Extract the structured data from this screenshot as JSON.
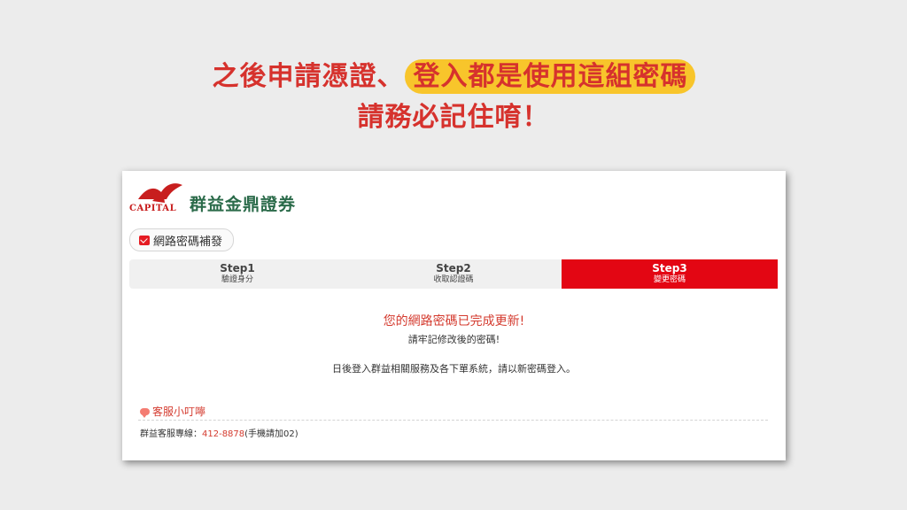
{
  "headline": {
    "line1_prefix": "之後申請憑證、",
    "line1_highlight": "登入都是使用這組密碼",
    "line2": "請務必記住唷！"
  },
  "logo": {
    "capital": "CAPITAL",
    "name": "群益金鼎證券"
  },
  "page_button": {
    "label": "網路密碼補發",
    "icon": "check-mail-icon"
  },
  "steps": [
    {
      "title": "Step1",
      "sub": "驗證身分"
    },
    {
      "title": "Step2",
      "sub": "收取認證碼"
    },
    {
      "title": "Step3",
      "sub": "變更密碼"
    }
  ],
  "active_step": 3,
  "result": {
    "title": "您的網路密碼已完成更新!",
    "subtitle": "請牢記修改後的密碼!",
    "note": "日後登入群益相關服務及各下單系統，請以新密碼登入。"
  },
  "customer_service": {
    "title": "客服小叮嚀",
    "hotline_label": "群益客服專線：",
    "hotline_number": "412-8878",
    "hotline_note": "(手機請加02)"
  },
  "colors": {
    "brand_red": "#e30613",
    "highlight": "#f8c52b",
    "headline": "#d6322d",
    "logo_green": "#2b6b4a"
  }
}
